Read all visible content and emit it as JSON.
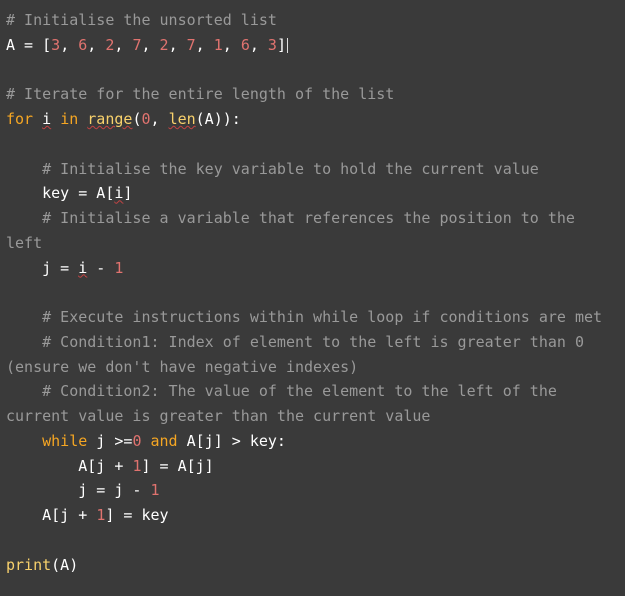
{
  "code": {
    "c1": "# Initialise the unsorted list",
    "l2_a": "A = [",
    "l2_n1": "3",
    "l2_s1": ", ",
    "l2_n2": "6",
    "l2_s2": ", ",
    "l2_n3": "2",
    "l2_s3": ", ",
    "l2_n4": "7",
    "l2_s4": ", ",
    "l2_n5": "2",
    "l2_s5": ", ",
    "l2_n6": "7",
    "l2_s6": ", ",
    "l2_n7": "1",
    "l2_s7": ", ",
    "l2_n8": "6",
    "l2_s8": ", ",
    "l2_n9": "3",
    "l2_b": "]",
    "c3": "# Iterate for the entire length of the list",
    "l4_for": "for",
    "l4_sp1": " ",
    "l4_i": "i",
    "l4_sp2": " ",
    "l4_in": "in",
    "l4_sp3": " ",
    "l4_range": "range",
    "l4_open": "(",
    "l4_zero": "0",
    "l4_comma": ", ",
    "l4_len": "len",
    "l4_o2": "(A)):",
    "c5": "    # Initialise the key variable to hold the current value",
    "l6_a": "    key = A[",
    "l6_i": "i",
    "l6_b": "]",
    "c7": "    # Initialise a variable that references the position to the left",
    "l8_a": "    j = ",
    "l8_i": "i",
    "l8_m": " - ",
    "l8_one": "1",
    "c9": "    # Execute instructions within while loop if conditions are met",
    "c10": "    # Condition1: Index of element to the left is greater than 0 (ensure we don't have negative indexes)",
    "c11": "    # Condition2: The value of the element to the left of the current value is greater than the current value",
    "l12_ind": "    ",
    "l12_while": "while",
    "l12_a": " j >=",
    "l12_zero": "0",
    "l12_sp": " ",
    "l12_and": "and",
    "l12_b": " A[j] > key:",
    "l13_a": "        A[j + ",
    "l13_one": "1",
    "l13_b": "] = A[j]",
    "l14_a": "        j = j - ",
    "l14_one": "1",
    "l15_a": "    A[j + ",
    "l15_one": "1",
    "l15_b": "] = key",
    "l16_print": "print",
    "l16_arg": "(A)"
  }
}
